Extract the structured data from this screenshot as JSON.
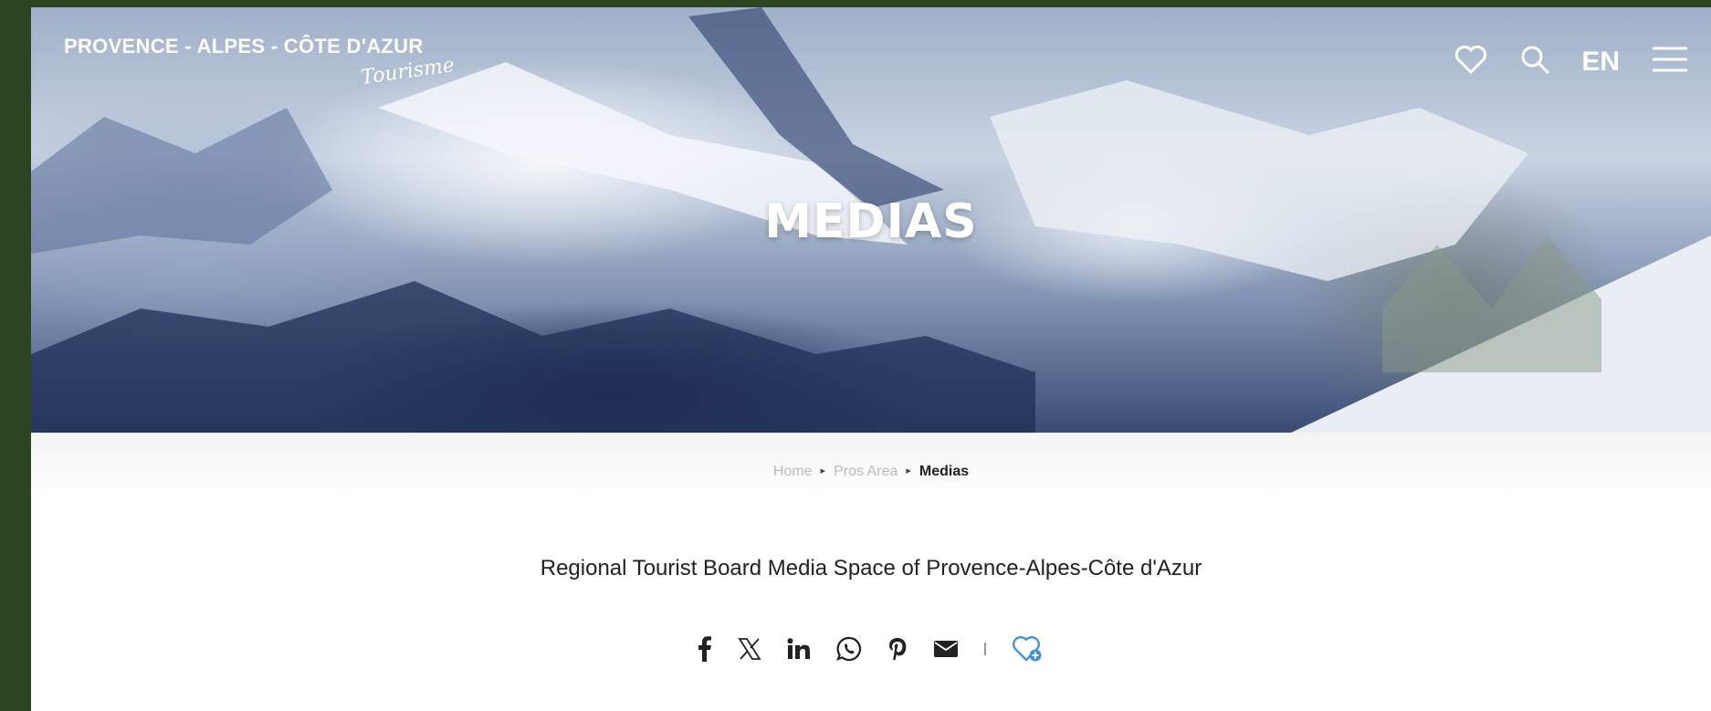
{
  "header": {
    "logo_line": "PROVENCE - ALPES - CÔTE D'AZUR",
    "logo_script": "Tourisme",
    "language": "EN",
    "icons": [
      "heart-icon",
      "search-icon",
      "menu-icon"
    ]
  },
  "hero": {
    "title": "MEDIAS"
  },
  "breadcrumb": {
    "items": [
      "Home",
      "Pros Area",
      "Medias"
    ]
  },
  "main": {
    "subtitle": "Regional Tourist Board Media Space of Provence-Alpes-Côte d'Azur"
  },
  "share": {
    "icons": [
      "facebook-icon",
      "x-icon",
      "linkedin-icon",
      "whatsapp-icon",
      "pinterest-icon",
      "email-icon",
      "favorite-add-icon"
    ],
    "accent": "#4a90d9"
  },
  "colors": {
    "outer_background": "#2c4420",
    "text": "#222222",
    "breadcrumb_muted": "#bbbbbb"
  }
}
